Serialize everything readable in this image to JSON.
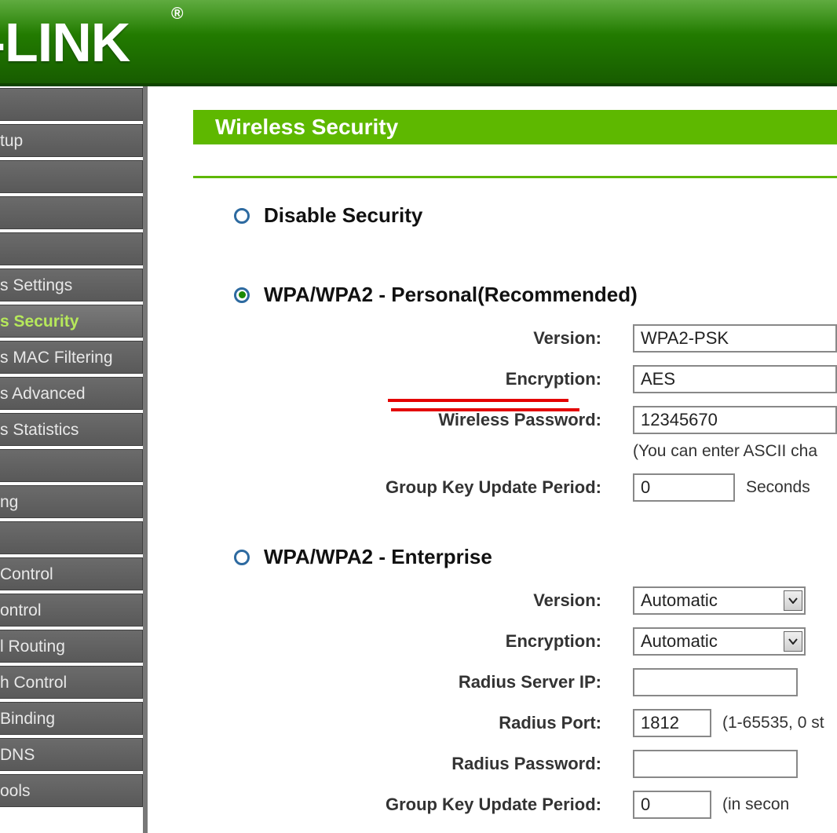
{
  "brand": "P-LINK",
  "brand_reg": "®",
  "page_title": "Wireless Security",
  "sidebar": {
    "items": [
      {
        "label": "",
        "blank": true
      },
      {
        "label": "tup"
      },
      {
        "label": ""
      },
      {
        "label": ""
      },
      {
        "label": "",
        "blank": true
      },
      {
        "label": "s Settings"
      },
      {
        "label": "s Security",
        "active": true
      },
      {
        "label": "s MAC Filtering"
      },
      {
        "label": "s Advanced"
      },
      {
        "label": "s Statistics"
      },
      {
        "label": "",
        "blank": true
      },
      {
        "label": "ng"
      },
      {
        "label": "",
        "blank": true
      },
      {
        "label": "Control"
      },
      {
        "label": "ontrol"
      },
      {
        "label": "l Routing"
      },
      {
        "label": "h Control"
      },
      {
        "label": "Binding"
      },
      {
        "label": "DNS"
      },
      {
        "label": "ools"
      }
    ]
  },
  "options": {
    "disable": {
      "label": "Disable Security",
      "checked": false
    },
    "personal": {
      "label": "WPA/WPA2 - Personal(Recommended)",
      "checked": true,
      "fields": {
        "version_label": "Version:",
        "version_value": "WPA2-PSK",
        "encryption_label": "Encryption:",
        "encryption_value": "AES",
        "password_label": "Wireless Password:",
        "password_value": "12345670",
        "password_hint": "(You can enter ASCII cha",
        "gkey_label": "Group Key Update Period:",
        "gkey_value": "0",
        "gkey_unit": "Seconds"
      }
    },
    "enterprise": {
      "label": "WPA/WPA2 - Enterprise",
      "checked": false,
      "fields": {
        "version_label": "Version:",
        "version_value": "Automatic",
        "encryption_label": "Encryption:",
        "encryption_value": "Automatic",
        "rserver_label": "Radius Server IP:",
        "rserver_value": "",
        "rport_label": "Radius Port:",
        "rport_value": "1812",
        "rport_hint": "(1-65535, 0 st",
        "rpass_label": "Radius Password:",
        "rpass_value": "",
        "gkey_label": "Group Key Update Period:",
        "gkey_value": "0",
        "gkey_unit": "(in secon"
      }
    }
  }
}
